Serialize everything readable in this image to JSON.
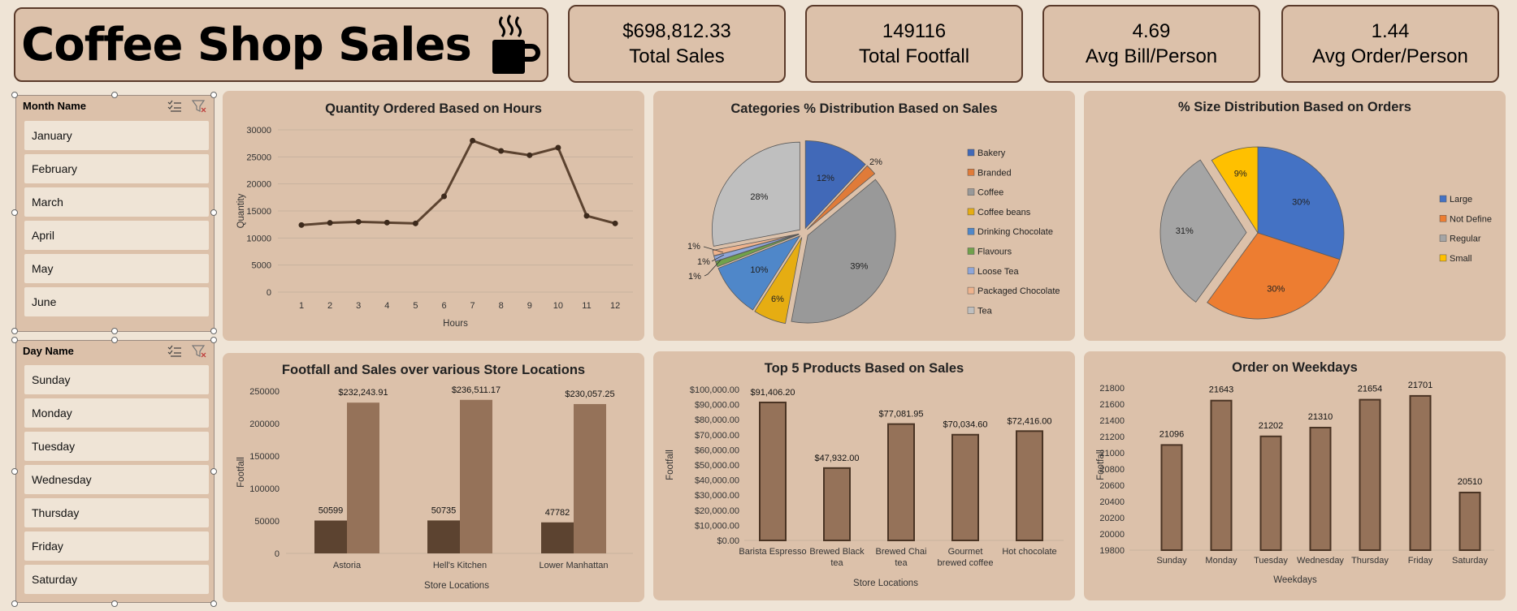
{
  "header": {
    "title": "Coffee Shop Sales",
    "icon": "coffee-cup-icon"
  },
  "kpis": [
    {
      "value": "$698,812.33",
      "label": "Total Sales"
    },
    {
      "value": "149116",
      "label": "Total Footfall"
    },
    {
      "value": "4.69",
      "label": "Avg Bill/Person"
    },
    {
      "value": "1.44",
      "label": "Avg Order/Person"
    }
  ],
  "slicers": {
    "month": {
      "title": "Month Name",
      "items": [
        "January",
        "February",
        "March",
        "April",
        "May",
        "June"
      ]
    },
    "day": {
      "title": "Day Name",
      "items": [
        "Sunday",
        "Monday",
        "Tuesday",
        "Wednesday",
        "Thursday",
        "Friday",
        "Saturday"
      ]
    }
  },
  "colors": {
    "bar": "#957259",
    "bar_dark": "#5c4330",
    "line": "#5c4330",
    "panel": "#dcc1aa",
    "background": "#efe4d6"
  },
  "chart_data": [
    {
      "id": "hours",
      "type": "line",
      "title": "Quantity Ordered Based on Hours",
      "xlabel": "Hours",
      "ylabel": "Quantity",
      "x": [
        1,
        2,
        3,
        4,
        5,
        6,
        7,
        8,
        9,
        10,
        11,
        12
      ],
      "y": [
        12400,
        12800,
        13000,
        12850,
        12700,
        17700,
        28000,
        26100,
        25300,
        26700,
        14100,
        12700
      ],
      "ylim": [
        0,
        30000
      ],
      "yticks": [
        0,
        5000,
        10000,
        15000,
        20000,
        25000,
        30000
      ],
      "grid": true
    },
    {
      "id": "categories",
      "type": "pie",
      "title": "Categories % Distribution Based on Sales",
      "legend": "right",
      "labels": [
        "Bakery",
        "Branded",
        "Coffee",
        "Coffee beans",
        "Drinking Chocolate",
        "Flavours",
        "Loose Tea",
        "Packaged Chocolate",
        "Tea"
      ],
      "values": [
        12,
        2,
        39,
        6,
        10,
        1,
        1,
        1,
        28
      ],
      "display": [
        "12%",
        "2%",
        "39%",
        "6%",
        "10%",
        "1%",
        "1%",
        "1%",
        "28%"
      ],
      "colors": [
        "#4169b8",
        "#e07b39",
        "#999999",
        "#e6ad12",
        "#4f87c9",
        "#70a14b",
        "#8fa6d9",
        "#efb38d",
        "#bfbfbf"
      ]
    },
    {
      "id": "sizes",
      "type": "pie",
      "title": "% Size Distribution Based on Orders",
      "legend": "right",
      "labels": [
        "Large",
        "Not Define",
        "Regular",
        "Small"
      ],
      "values": [
        30,
        30,
        31,
        9
      ],
      "display": [
        "30%",
        "30%",
        "31%",
        "9%"
      ],
      "colors": [
        "#4472c4",
        "#ed7d31",
        "#a5a5a5",
        "#ffc000"
      ]
    },
    {
      "id": "stores",
      "type": "bar",
      "title": "Footfall and Sales over various Store Locations",
      "xlabel": "Store Locations",
      "ylabel": "Footfall",
      "categories": [
        "Astoria",
        "Hell's Kitchen",
        "Lower Manhattan"
      ],
      "series": [
        {
          "values": [
            50599,
            50735,
            47782
          ],
          "labels": [
            "50599",
            "50735",
            "47782"
          ]
        },
        {
          "values": [
            232243.91,
            236511.17,
            230057.25
          ],
          "labels": [
            "$232,243.91",
            "$236,511.17",
            "$230,057.25"
          ]
        }
      ],
      "ylim": [
        0,
        250000
      ],
      "yticks": [
        0,
        50000,
        100000,
        150000,
        200000,
        250000
      ]
    },
    {
      "id": "products",
      "type": "bar",
      "title": "Top 5 Products Based on Sales",
      "xlabel": "Store Locations",
      "ylabel": "Footfall",
      "categories": [
        [
          "Barista Espresso"
        ],
        [
          "Brewed Black",
          "tea"
        ],
        [
          "Brewed Chai",
          "tea"
        ],
        [
          "Gourmet",
          "brewed coffee"
        ],
        [
          "Hot chocolate"
        ]
      ],
      "values": [
        91406.2,
        47932.0,
        77081.95,
        70034.6,
        72416.0
      ],
      "labels": [
        "$91,406.20",
        "$47,932.00",
        "$77,081.95",
        "$70,034.60",
        "$72,416.00"
      ],
      "ylim": [
        0,
        100000
      ],
      "yticks": [
        "$0.00",
        "$10,000.00",
        "$20,000.00",
        "$30,000.00",
        "$40,000.00",
        "$50,000.00",
        "$60,000.00",
        "$70,000.00",
        "$80,000.00",
        "$90,000.00",
        "$100,000.00"
      ]
    },
    {
      "id": "weekdays",
      "type": "bar",
      "title": "Order on Weekdays",
      "xlabel": "Weekdays",
      "ylabel": "Footfall",
      "categories": [
        "Sunday",
        "Monday",
        "Tuesday",
        "Wednesday",
        "Thursday",
        "Friday",
        "Saturday"
      ],
      "values": [
        21096,
        21643,
        21202,
        21310,
        21654,
        21701,
        20510
      ],
      "labels": [
        "21096",
        "21643",
        "21202",
        "21310",
        "21654",
        "21701",
        "20510"
      ],
      "ylim": [
        19800,
        21800
      ],
      "yticks": [
        "19800",
        "20000",
        "20200",
        "20400",
        "20600",
        "20800",
        "21000",
        "21200",
        "21400",
        "21600",
        "21800"
      ]
    }
  ]
}
